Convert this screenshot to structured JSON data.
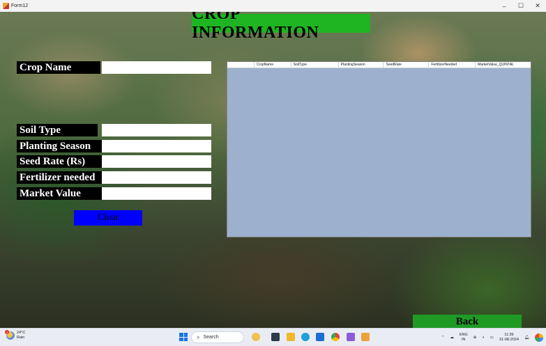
{
  "window": {
    "title": "Form12",
    "minimize": "–",
    "maximize": "☐",
    "close": "✕"
  },
  "page_title": "CROP INFORMATION",
  "fields": [
    {
      "label": "Crop Name",
      "value": ""
    },
    {
      "label": "Soil Type",
      "value": ""
    },
    {
      "label": "Planting Season",
      "value": ""
    },
    {
      "label": "Seed Rate (Rs)",
      "value": ""
    },
    {
      "label": "Fertilizer needed",
      "value": ""
    },
    {
      "label": "Market Value",
      "value": ""
    }
  ],
  "buttons": {
    "clear": "Clear",
    "back": "Back"
  },
  "grid": {
    "columns": [
      "CropName",
      "SoilType",
      "PlantingSeason",
      "SeedRate",
      "FertilizerNeeded",
      "MarketValue_QUINTAL"
    ],
    "rows": []
  },
  "taskbar": {
    "weather_temp": "24°C",
    "weather_cond": "Rain",
    "search_placeholder": "Search",
    "lang_line1": "ENG",
    "lang_line2": "IN",
    "time": "11:39",
    "date": "31-08-2024"
  }
}
